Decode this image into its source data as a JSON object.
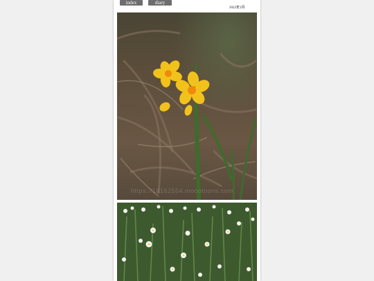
{
  "nav": {
    "index_label": "index",
    "diary_index_label": "diary index"
  },
  "header": {
    "date_text": "2022年1月"
  },
  "photos": [
    {
      "watermark_text": "https://16162564.mocotoons.com"
    },
    {}
  ],
  "colors": {
    "page_bg": "#ffffff",
    "outer_bg": "#f0f0f0",
    "nav_button": "#6e6e6e",
    "flower_petal": "#f2c21c",
    "flower_center": "#f08a0a"
  }
}
